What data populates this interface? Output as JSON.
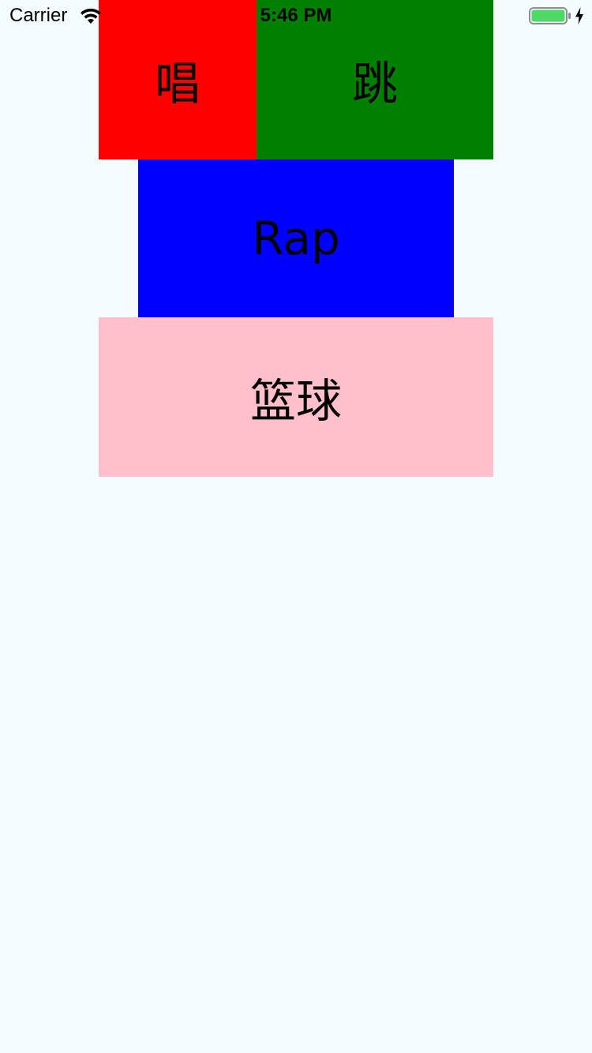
{
  "status_bar": {
    "carrier": "Carrier",
    "time": "5:46 PM",
    "wifi_icon": "wifi-icon",
    "battery_icon": "battery-full-icon",
    "charging_icon": "charging-bolt-icon",
    "battery_color": "#4CD964"
  },
  "blocks": {
    "sing": {
      "label": "唱",
      "color": "#FF0000"
    },
    "dance": {
      "label": "跳",
      "color": "#008000"
    },
    "rap": {
      "label": "Rap",
      "color": "#0000FF"
    },
    "basketball": {
      "label": "篮球",
      "color": "#FFC0CB"
    }
  },
  "background": "#F5FCFF"
}
